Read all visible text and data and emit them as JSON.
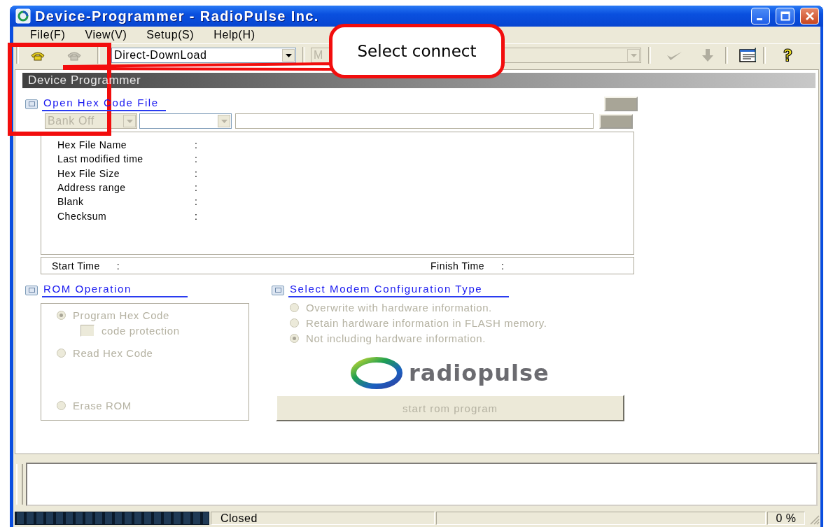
{
  "window": {
    "title": "Device-Programmer - RadioPulse Inc."
  },
  "menu": [
    {
      "label": "File(F)"
    },
    {
      "label": "View(V)"
    },
    {
      "label": "Setup(S)"
    },
    {
      "label": "Help(H)"
    }
  ],
  "toolbar": {
    "mode_combo": {
      "value": "Direct-DownLoad",
      "disabled": false
    },
    "port_combo": {
      "value": "M",
      "disabled": true
    }
  },
  "panel_title": "Device Programmer",
  "hex_section": {
    "title": "Open Hex Code File",
    "bank_combo": {
      "value": "Bank Off",
      "disabled": true
    },
    "info": [
      {
        "label": "Hex File Name",
        "colon": ":"
      },
      {
        "label": "Last modified time",
        "colon": ":"
      },
      {
        "label": "Hex File Size",
        "colon": ":"
      },
      {
        "label": "Address range",
        "colon": ":"
      },
      {
        "label": "Blank",
        "colon": ":"
      },
      {
        "label": "Checksum",
        "colon": ":"
      }
    ],
    "times": [
      {
        "label": "Start Time",
        "colon": ":"
      },
      {
        "label": "Finish Time",
        "colon": ":"
      }
    ]
  },
  "rom_section": {
    "title": "ROM Operation",
    "disabled": true,
    "options": [
      {
        "kind": "radio",
        "label": "Program Hex Code",
        "selected": true
      },
      {
        "kind": "checkbox",
        "label": "code protection",
        "checked": false
      },
      {
        "kind": "radio",
        "label": "Read Hex Code",
        "selected": false
      },
      {
        "kind": "radio",
        "label": "Erase ROM",
        "selected": false
      }
    ]
  },
  "modem_section": {
    "title": "Select Modem Configuration Type",
    "disabled": true,
    "options": [
      {
        "label": "Overwrite with hardware information.",
        "selected": false
      },
      {
        "label": "Retain hardware information in FLASH memory.",
        "selected": false
      },
      {
        "label": "Not including hardware information.",
        "selected": true
      }
    ]
  },
  "logo": {
    "text": "radiopulse"
  },
  "start_button": {
    "label": "start rom program",
    "disabled": true
  },
  "status_bar": {
    "status": "Closed",
    "percent": "0 %"
  },
  "annotation": {
    "text": "Select connect"
  }
}
